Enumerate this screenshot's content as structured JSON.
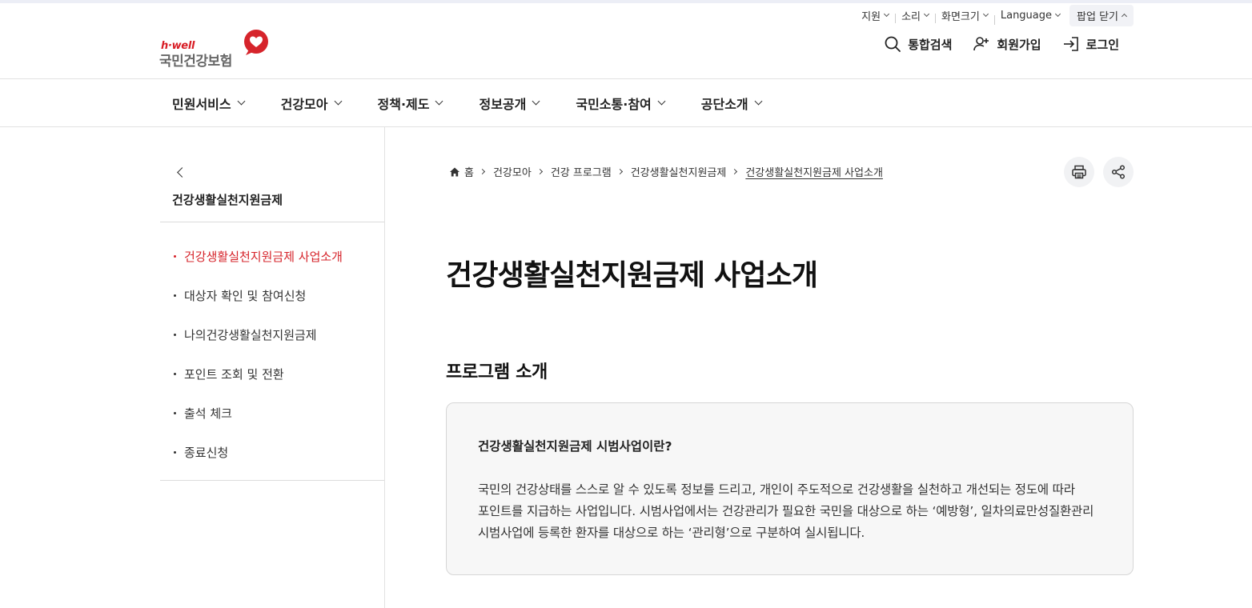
{
  "utility": {
    "support": "지원",
    "sound": "소리",
    "screen_size": "화면크기",
    "language": "Language",
    "popup_close": "팝업 닫기"
  },
  "logo": {
    "en": "h·well",
    "ko": "국민건강보험"
  },
  "header": {
    "search": "통합검색",
    "signup": "회원가입",
    "login": "로그인"
  },
  "gnb": [
    "민원서비스",
    "건강모아",
    "정책·제도",
    "정보공개",
    "국민소통·참여",
    "공단소개"
  ],
  "lnb": {
    "title": "건강생활실천지원금제",
    "items": [
      "건강생활실천지원금제 사업소개",
      "대상자 확인 및 참여신청",
      "나의건강생활실천지원금제",
      "포인트 조회 및 전환",
      "출석 체크",
      "종료신청"
    ],
    "active_index": 0
  },
  "breadcrumb": {
    "home": "홈",
    "items": [
      "건강모아",
      "건강 프로그램",
      "건강생활실천지원금제"
    ],
    "current": "건강생활실천지원금제 사업소개"
  },
  "page": {
    "title": "건강생활실천지원금제 사업소개",
    "section_title": "프로그램 소개",
    "box_heading": "건강생활실천지원금제 시범사업이란?",
    "box_body": "국민의 건강상태를 스스로 알 수 있도록 정보를 드리고, 개인이 주도적으로 건강생활을 실천하고 개선되는 정도에 따라 포인트를 지급하는 사업입니다. 시범사업에서는 건강관리가 필요한 국민을 대상으로 하는 ‘예방형’, 일차의료만성질환관리 시범사업에 등록한 환자를 대상으로 하는 ‘관리형’으로 구분하여 실시됩니다."
  },
  "colors": {
    "brand_red": "#d6242b",
    "divider": "#e2e2e2",
    "box_bg": "#f7f7f7"
  },
  "icons": {
    "search": "search-icon",
    "signup": "user-plus-icon",
    "login": "login-icon",
    "print": "print-icon",
    "share": "share-icon",
    "home": "home-icon",
    "back": "chevron-left-icon"
  }
}
